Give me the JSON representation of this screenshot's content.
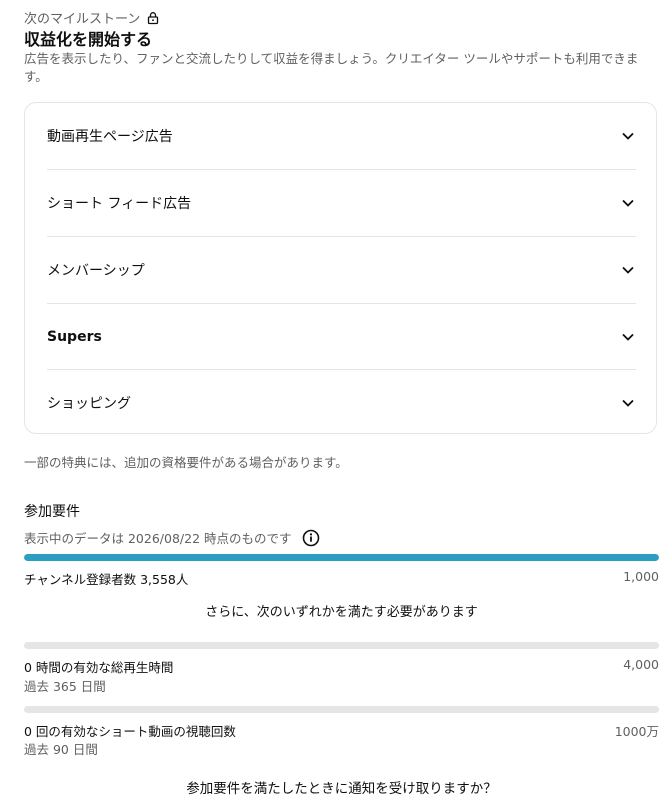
{
  "milestone": {
    "label": "次のマイルストーン",
    "icon": "lock-icon"
  },
  "title": "収益化を開始する",
  "description": "広告を表示したり、ファンと交流したりして収益を得ましょう。クリエイター ツールやサポートも利用できます。",
  "features": [
    {
      "label": "動画再生ページ広告",
      "bold": false
    },
    {
      "label": "ショート フィード広告",
      "bold": false
    },
    {
      "label": "メンバーシップ",
      "bold": false
    },
    {
      "label": "Supers",
      "bold": true
    },
    {
      "label": "ショッピング",
      "bold": false
    }
  ],
  "note": "一部の特典には、追加の資格要件がある場合があります。",
  "requirements": {
    "title": "参加要件",
    "date_text": "表示中のデータは 2026/08/22 時点のものです",
    "subscribers": {
      "label": "チャンネル登録者数 3,558人",
      "target": "1,000",
      "progress": 1.0
    },
    "also_needed": "さらに、次のいずれかを満たす必要があります",
    "watch_hours": {
      "label": "0 時間の有効な総再生時間",
      "period": "過去 365 日間",
      "target": "4,000",
      "progress": 0.0
    },
    "shorts_views": {
      "label": "0 回の有効なショート動画の視聴回数",
      "period": "過去 90 日間",
      "target": "1000万",
      "progress": 0.0
    }
  },
  "notify_question": "参加要件を満たしたときに通知を受け取りますか？",
  "colors": {
    "accent": "#2c9ec4",
    "track": "#e5e5e5",
    "secondary_text": "#606060"
  }
}
